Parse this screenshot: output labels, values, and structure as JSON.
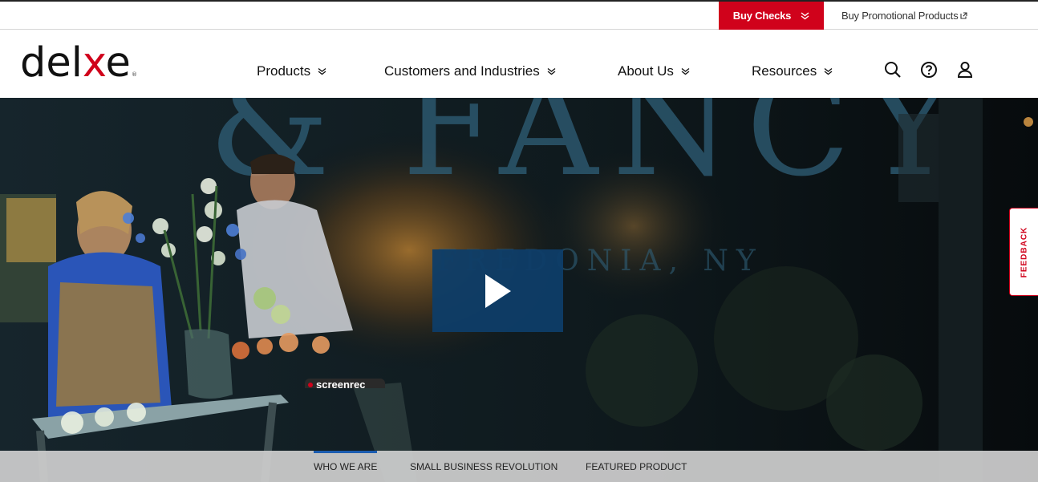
{
  "utility": {
    "buy_checks": "Buy Checks",
    "promo": "Buy Promotional Products"
  },
  "header": {
    "logo_start": "del",
    "logo_x": "x",
    "logo_end": "e",
    "logo_reg": "®",
    "nav": [
      {
        "label": "Products"
      },
      {
        "label": "Customers and Industries"
      },
      {
        "label": "About Us"
      },
      {
        "label": "Resources"
      }
    ],
    "icons": [
      "search-icon",
      "help-icon",
      "user-icon"
    ]
  },
  "hero": {
    "feedback": "FEEDBACK",
    "tabs": [
      {
        "label": "WHO WE ARE",
        "active": true
      },
      {
        "label": "SMALL BUSINESS REVOLUTION",
        "active": false
      },
      {
        "label": "FEATURED PRODUCT",
        "active": false
      }
    ],
    "recorder_label": "screenrec"
  },
  "colors": {
    "brand_red": "#d0021b",
    "play_blue": "#0e3d68",
    "tab_active": "#1a5cb0"
  }
}
